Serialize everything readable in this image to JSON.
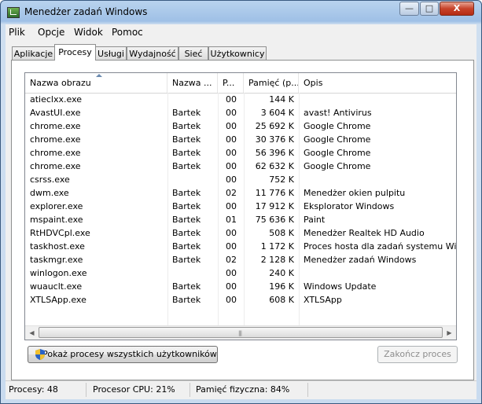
{
  "window": {
    "title": "Menedżer zadań Windows"
  },
  "controls": {
    "minimize": "—",
    "maximize": "□",
    "close": "X"
  },
  "menu": [
    "Plik",
    "Opcje",
    "Widok",
    "Pomoc"
  ],
  "tabs": [
    "Aplikacje",
    "Procesy",
    "Usługi",
    "Wydajność",
    "Sieć",
    "Użytkownicy"
  ],
  "active_tab": "Procesy",
  "columns": [
    "Nazwa obrazu",
    "Nazwa ...",
    "P...",
    "Pamięć (p...",
    "Opis"
  ],
  "processes": [
    {
      "name": "atieclxx.exe",
      "user": "",
      "cpu": "00",
      "mem": "144 K",
      "desc": ""
    },
    {
      "name": "AvastUI.exe",
      "user": "Bartek",
      "cpu": "00",
      "mem": "3 604 K",
      "desc": "avast! Antivirus"
    },
    {
      "name": "chrome.exe",
      "user": "Bartek",
      "cpu": "00",
      "mem": "25 692 K",
      "desc": "Google Chrome"
    },
    {
      "name": "chrome.exe",
      "user": "Bartek",
      "cpu": "00",
      "mem": "30 376 K",
      "desc": "Google Chrome"
    },
    {
      "name": "chrome.exe",
      "user": "Bartek",
      "cpu": "00",
      "mem": "56 396 K",
      "desc": "Google Chrome"
    },
    {
      "name": "chrome.exe",
      "user": "Bartek",
      "cpu": "00",
      "mem": "62 632 K",
      "desc": "Google Chrome"
    },
    {
      "name": "csrss.exe",
      "user": "",
      "cpu": "00",
      "mem": "752 K",
      "desc": ""
    },
    {
      "name": "dwm.exe",
      "user": "Bartek",
      "cpu": "02",
      "mem": "11 776 K",
      "desc": "Menedżer okien pulpitu"
    },
    {
      "name": "explorer.exe",
      "user": "Bartek",
      "cpu": "00",
      "mem": "17 912 K",
      "desc": "Eksplorator Windows"
    },
    {
      "name": "mspaint.exe",
      "user": "Bartek",
      "cpu": "01",
      "mem": "75 636 K",
      "desc": "Paint"
    },
    {
      "name": "RtHDVCpl.exe",
      "user": "Bartek",
      "cpu": "00",
      "mem": "508 K",
      "desc": "Menedżer Realtek HD Audio"
    },
    {
      "name": "taskhost.exe",
      "user": "Bartek",
      "cpu": "00",
      "mem": "1 172 K",
      "desc": "Proces hosta dla zadań systemu Win..."
    },
    {
      "name": "taskmgr.exe",
      "user": "Bartek",
      "cpu": "02",
      "mem": "2 128 K",
      "desc": "Menedżer zadań Windows"
    },
    {
      "name": "winlogon.exe",
      "user": "",
      "cpu": "00",
      "mem": "240 K",
      "desc": ""
    },
    {
      "name": "wuauclt.exe",
      "user": "Bartek",
      "cpu": "00",
      "mem": "196 K",
      "desc": "Windows Update"
    },
    {
      "name": "XTLSApp.exe",
      "user": "Bartek",
      "cpu": "00",
      "mem": "608 K",
      "desc": "XTLSApp"
    }
  ],
  "buttons": {
    "show_all": "Pokaż procesy wszystkich użytkowników",
    "end_process": "Zakończ proces"
  },
  "status": {
    "processes": "Procesy: 48",
    "cpu": "Procesor CPU: 21%",
    "memory": "Pamięć fizyczna: 84%"
  }
}
